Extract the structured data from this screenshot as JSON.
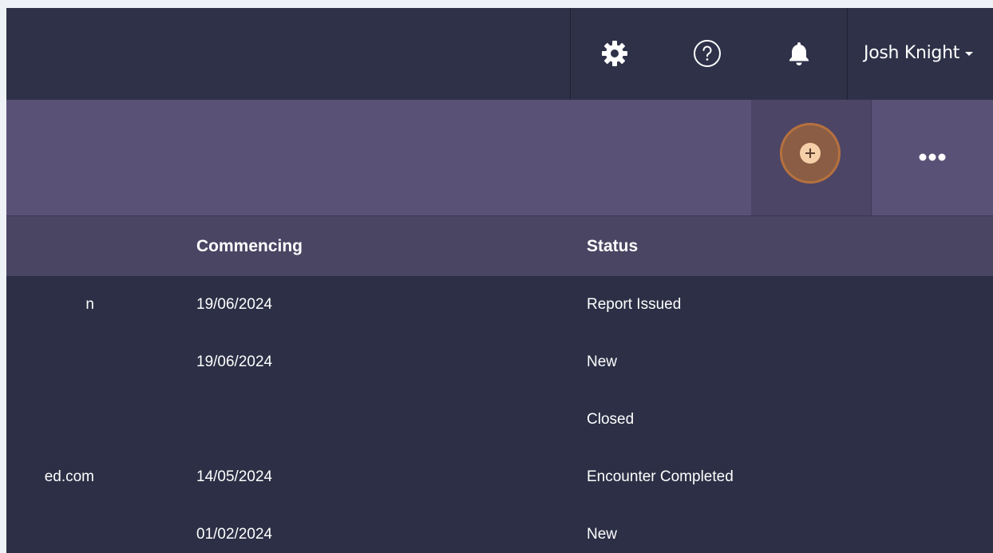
{
  "header": {
    "settings_icon": "gear-icon",
    "help_icon": "question-circle-icon",
    "notifications_icon": "bell-icon",
    "user_name": "Josh Knight"
  },
  "actions": {
    "add_icon": "plus-circle-icon",
    "more_icon": "ellipsis-icon"
  },
  "table": {
    "columns": [
      "Commencing",
      "Status"
    ],
    "rows": [
      {
        "email": "n",
        "commencing": "19/06/2024",
        "status": "Report Issued"
      },
      {
        "email": "",
        "commencing": "19/06/2024",
        "status": "New"
      },
      {
        "email": "",
        "commencing": "",
        "status": "Closed"
      },
      {
        "email": "ed.com",
        "commencing": "14/05/2024",
        "status": "Encounter Completed"
      },
      {
        "email": "",
        "commencing": "01/02/2024",
        "status": "New"
      }
    ]
  }
}
